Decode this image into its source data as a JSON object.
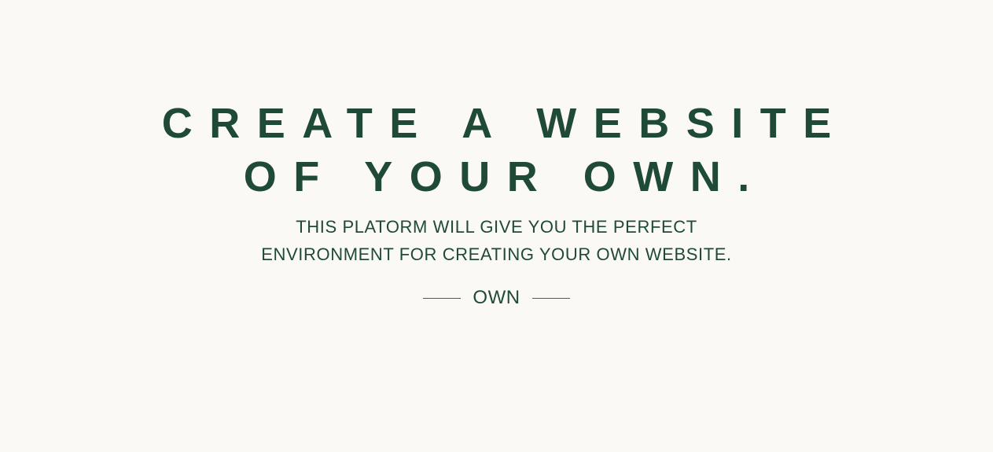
{
  "hero": {
    "headline_line1": "CREATE A WEBSITE",
    "headline_line2": "OF YOUR OWN.",
    "subtitle_line1": "THIS PLATORM WILL GIVE YOU THE PERFECT",
    "subtitle_line2": "ENVIRONMENT FOR CREATING YOUR OWN WEBSITE.",
    "tagline": "OWN"
  },
  "colors": {
    "background": "#faf9f6",
    "text": "#1f4a36"
  }
}
